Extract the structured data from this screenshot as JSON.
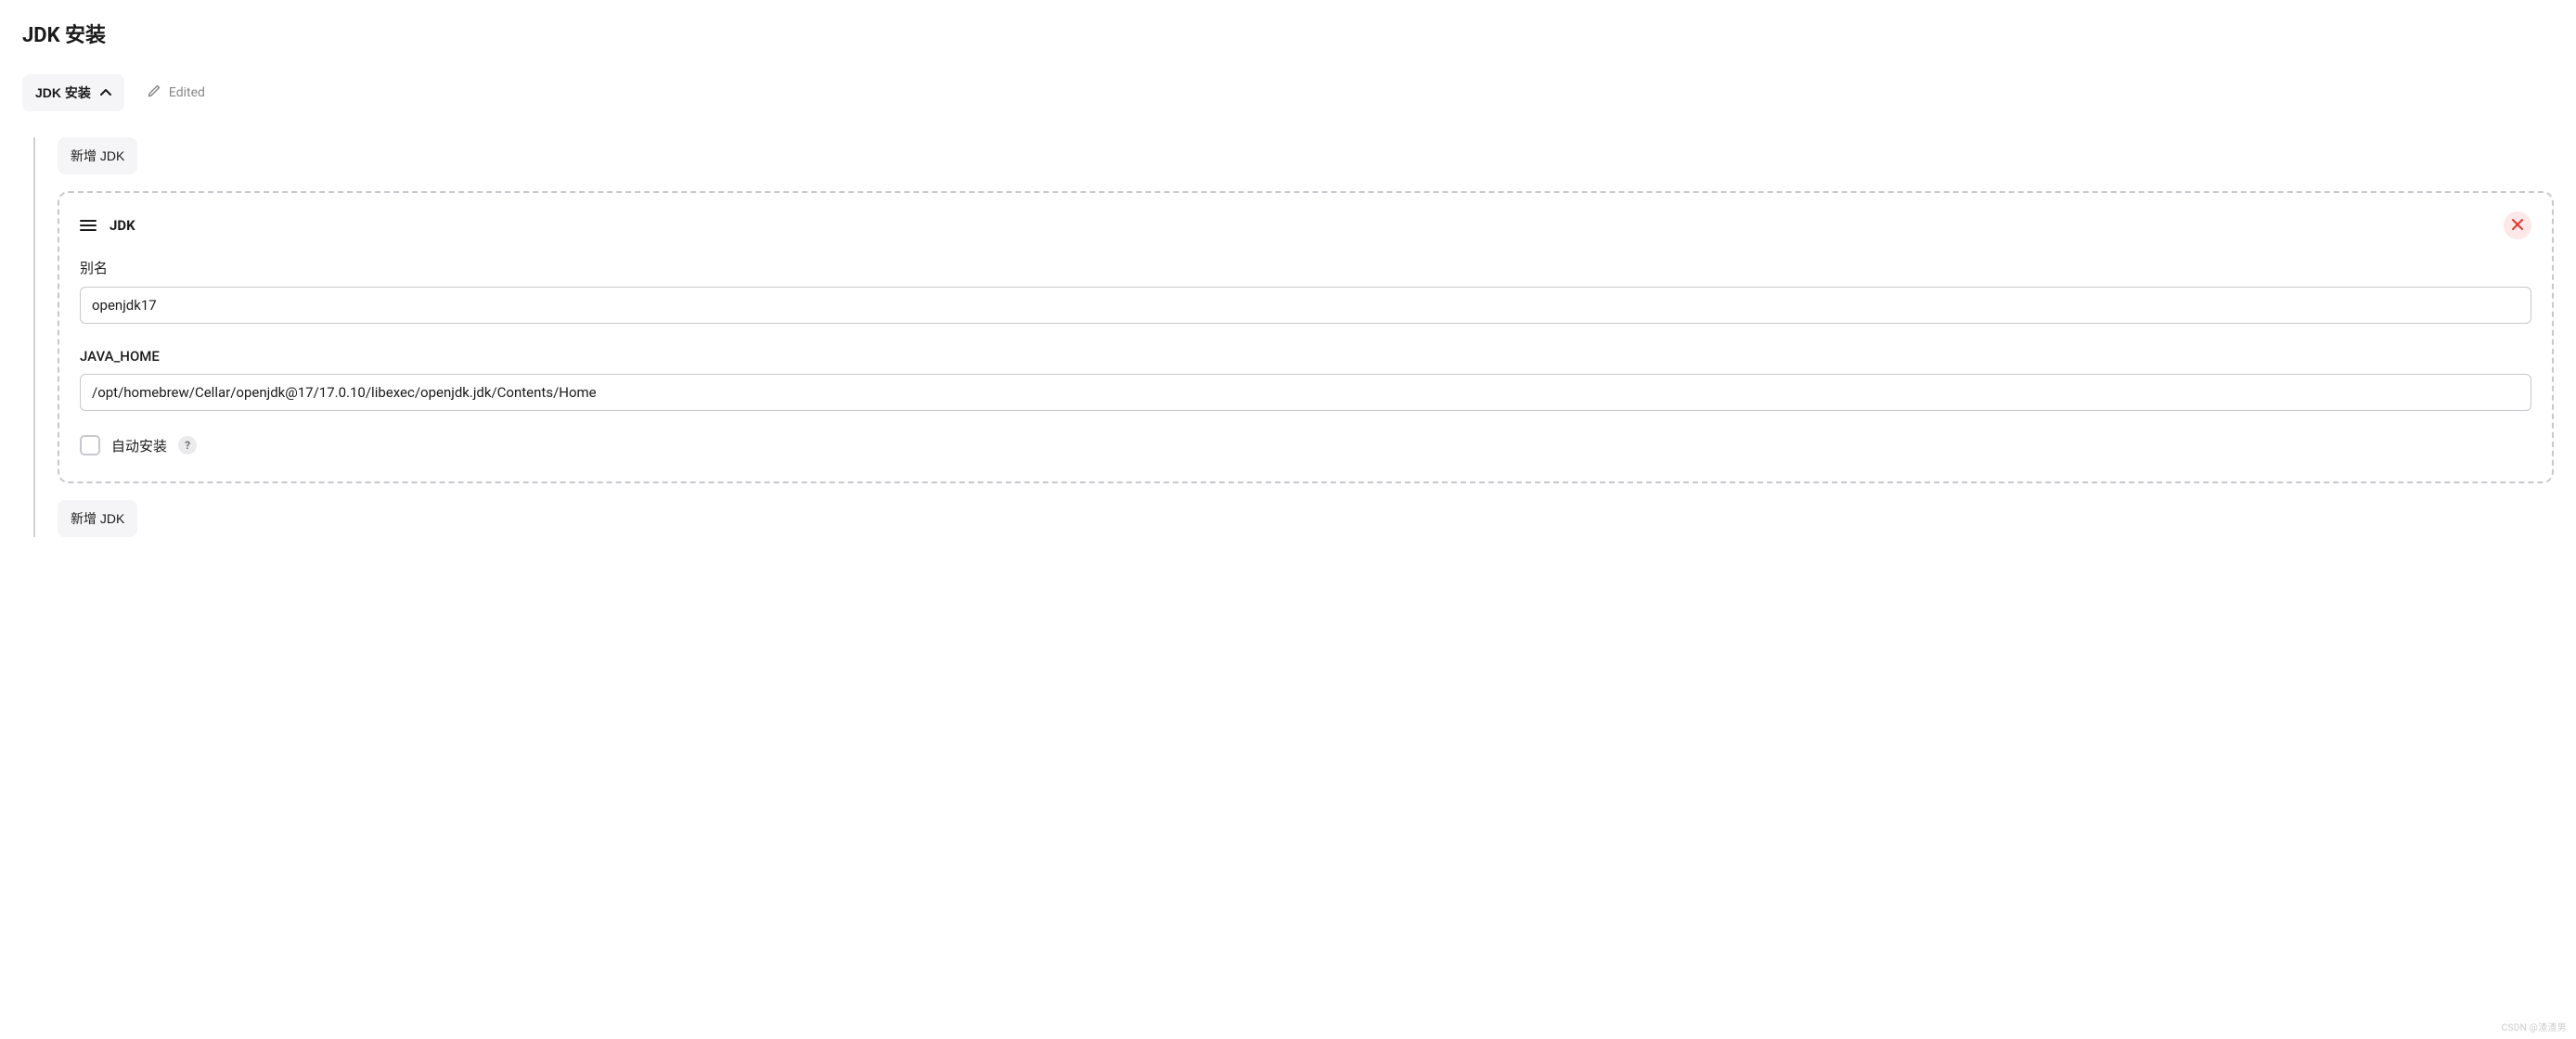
{
  "page": {
    "title": "JDK 安装"
  },
  "header": {
    "section_toggle_label": "JDK 安装",
    "edited_label": "Edited"
  },
  "buttons": {
    "add_jdk_top": "新增 JDK",
    "add_jdk_bottom": "新增 JDK"
  },
  "jdk_card": {
    "title": "JDK",
    "alias_label": "别名",
    "alias_value": "openjdk17",
    "java_home_label": "JAVA_HOME",
    "java_home_value": "/opt/homebrew/Cellar/openjdk@17/17.0.10/libexec/openjdk.jdk/Contents/Home",
    "auto_install_label": "自动安装",
    "auto_install_checked": false,
    "help_text": "?"
  },
  "watermark": "CSDN @渣渣男"
}
